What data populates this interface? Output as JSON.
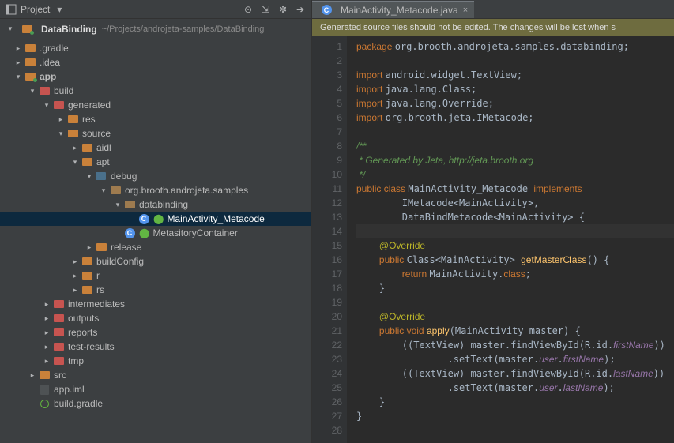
{
  "toolbar": {
    "project_label": "Project"
  },
  "breadcrumb": {
    "project": "DataBinding",
    "path": "~/Projects/androjeta-samples/DataBinding"
  },
  "tree": {
    "gradle": ".gradle",
    "idea": ".idea",
    "app": "app",
    "build": "build",
    "generated": "generated",
    "res": "res",
    "source": "source",
    "aidl": "aidl",
    "apt": "apt",
    "debug": "debug",
    "pkg": "org.brooth.androjeta.samples",
    "databinding": "databinding",
    "mainactivity": "MainActivity_Metacode",
    "metasitory": "MetasitoryContainer",
    "release": "release",
    "buildconfig": "buildConfig",
    "r": "r",
    "rs": "rs",
    "intermediates": "intermediates",
    "outputs": "outputs",
    "reports": "reports",
    "testresults": "test-results",
    "tmp": "tmp",
    "src": "src",
    "appiml": "app.iml",
    "buildgradle": "build.gradle"
  },
  "tab": {
    "name": "MainActivity_Metacode.java"
  },
  "banner": "Generated source files should not be edited. The changes will be lost when s",
  "code": {
    "l1": "package org.brooth.androjeta.samples.databinding;",
    "l3": "import android.widget.TextView;",
    "l4": "import java.lang.Class;",
    "l5": "import java.lang.Override;",
    "l6": "import org.brooth.jeta.IMetacode;",
    "l8": "/**",
    "l9": " * Generated by Jeta, http://jeta.brooth.org",
    "l10": " */",
    "l11a": "public class ",
    "l11b": "MainActivity_Metacode ",
    "l11c": "implements",
    "l12": "        IMetacode<MainActivity>,",
    "l13": "        DataBindMetacode<MainActivity> {",
    "l15": "@Override",
    "l16a": "    public ",
    "l16b": "Class<MainActivity> ",
    "l16c": "getMasterClass",
    "l16d": "() {",
    "l17a": "        return ",
    "l17b": "MainActivity.",
    "l17c": "class;",
    "l18": "    }",
    "l20": "@Override",
    "l21a": "    public void ",
    "l21b": "apply",
    "l21c": "(MainActivity master) {",
    "l22a": "        ((TextView) master.findViewById(R.id.",
    "l22b": "firstName",
    "l22c": "))",
    "l23a": "                .setText(master.",
    "l23b": "user",
    "l23c": ".",
    "l23d": "firstName",
    "l23e": ");",
    "l24a": "        ((TextView) master.findViewById(R.id.",
    "l24b": "lastName",
    "l24c": "))",
    "l25a": "                .setText(master.",
    "l25b": "user",
    "l25c": ".",
    "l25d": "lastName",
    "l25e": ");",
    "l26": "    }",
    "l27": "}"
  }
}
